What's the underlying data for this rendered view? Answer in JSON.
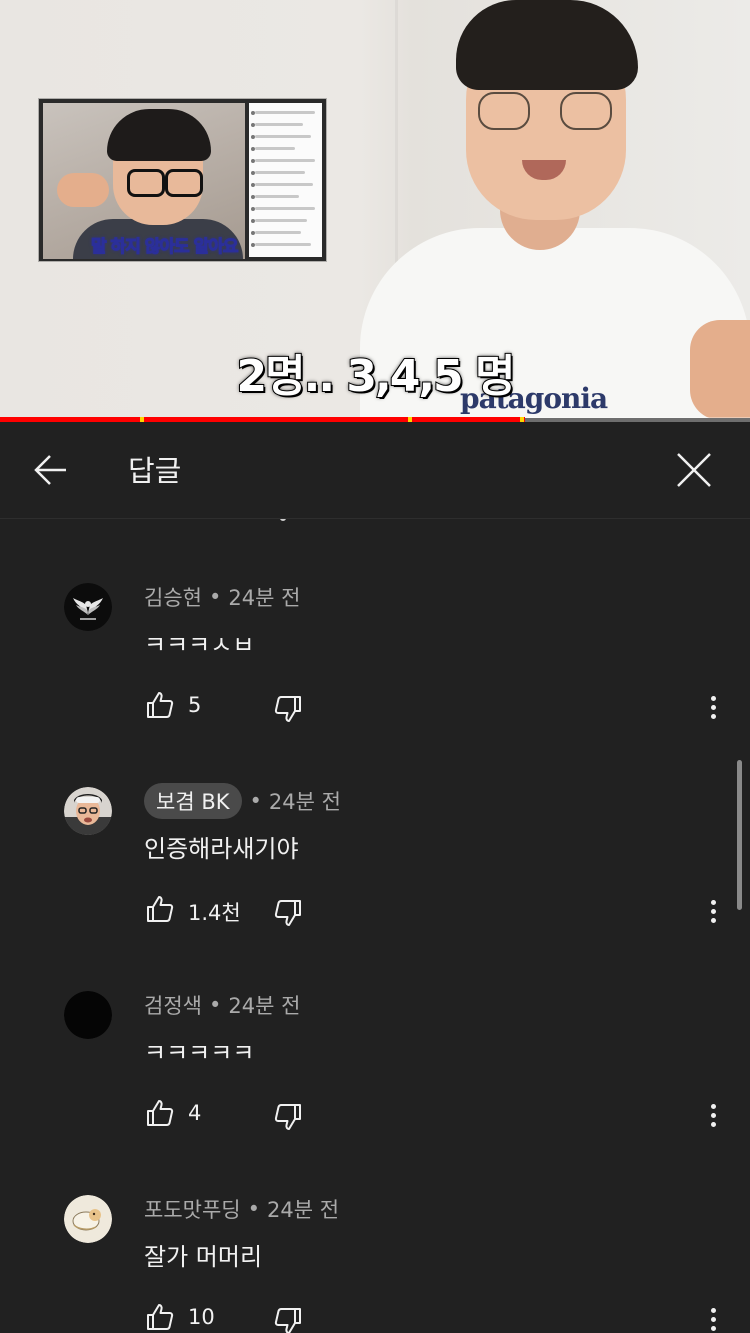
{
  "video": {
    "inset_caption": "말 하지 않아도 알아요",
    "caption": "2명.. 3,4,5 명",
    "shirt_logo": "patagonia",
    "progress_fraction": 0.7
  },
  "header": {
    "title": "답글",
    "back_icon": "arrow-left-icon",
    "close_icon": "close-icon"
  },
  "comments": [
    {
      "author": "김승현",
      "time": "24분 전",
      "text": "ㅋㅋㅋㅅㅂ",
      "likes": "5",
      "author_chip": false,
      "avatar": "wings-emblem"
    },
    {
      "author": "보겸 BK",
      "time": "24분 전",
      "text": "인증해라새기야",
      "likes": "1.4천",
      "author_chip": true,
      "avatar": "person-photo"
    },
    {
      "author": "검정색",
      "time": "24분 전",
      "text": "ㅋㅋㅋㅋㅋ",
      "likes": "4",
      "author_chip": false,
      "avatar": "black-circle"
    },
    {
      "author": "포도맛푸딩",
      "time": "24분 전",
      "text": "잘가 머머리",
      "likes": "10",
      "author_chip": false,
      "avatar": "cartoon-image"
    }
  ],
  "separator": "•",
  "colors": {
    "background": "#212121",
    "text": "#f1f1f1",
    "meta": "#aaaaaa",
    "progress": "#ff0000",
    "chip": "#4a4a4a"
  }
}
